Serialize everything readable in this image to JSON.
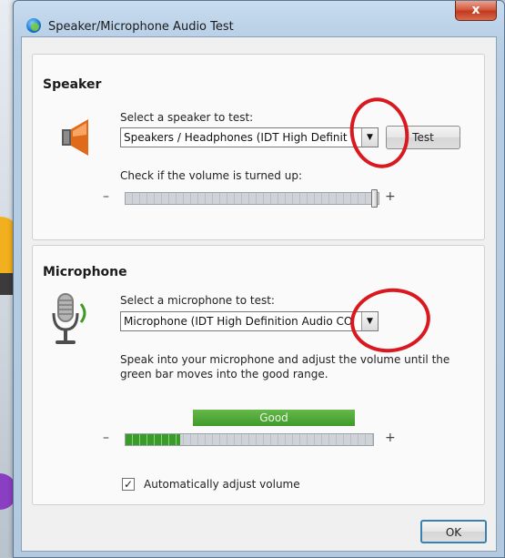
{
  "window": {
    "title": "Speaker/Microphone Audio Test",
    "close_glyph": "x"
  },
  "speaker": {
    "heading": "Speaker",
    "select_label": "Select a speaker to test:",
    "selected_device": "Speakers / Headphones (IDT High Definit",
    "test_button": "Test",
    "volume_label": "Check if the volume is turned up:",
    "minus": "–",
    "plus": "+",
    "volume_level": 0.98
  },
  "microphone": {
    "heading": "Microphone",
    "select_label": "Select a microphone to test:",
    "selected_device": "Microphone (IDT High Definition Audio CO",
    "instruction_line1": "Speak into your microphone and adjust the volume until the",
    "instruction_line2": "green bar moves into the good range.",
    "good_label": "Good",
    "minus": "–",
    "plus": "+",
    "input_level": 0.22,
    "auto_adjust_label": "Automatically adjust volume",
    "auto_adjust_checked": true
  },
  "footer": {
    "ok_button": "OK"
  },
  "colors": {
    "annotation_red": "#d9181f",
    "good_green": "#3f9a29"
  },
  "icons": [
    "speaker-icon",
    "microphone-icon",
    "app-globe-icon",
    "close-icon",
    "dropdown-arrow-icon"
  ]
}
